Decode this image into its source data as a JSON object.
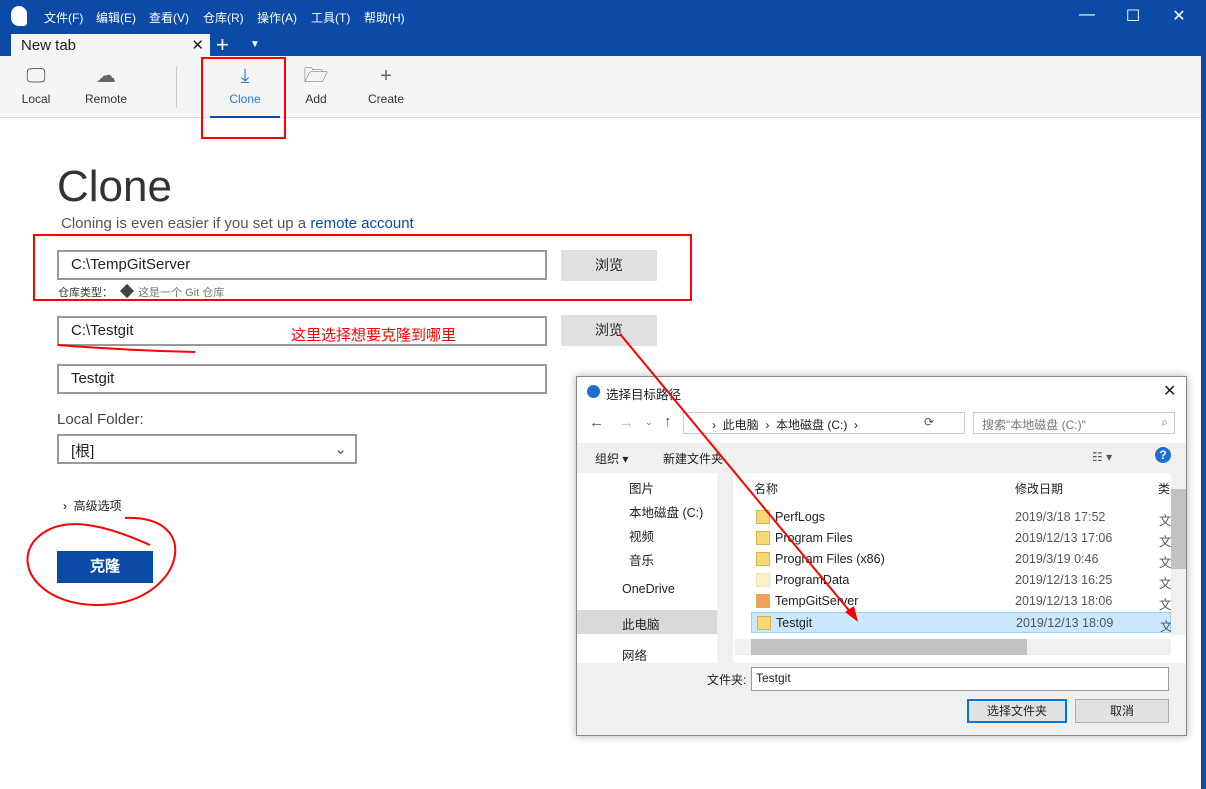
{
  "app": {
    "menu": [
      "文件(F)",
      "编辑(E)",
      "查看(V)",
      "仓库(R)",
      "操作(A)",
      "工具(T)",
      "帮助(H)"
    ],
    "tab_label": "New tab"
  },
  "toolbar": {
    "local": "Local",
    "remote": "Remote",
    "clone": "Clone",
    "add": "Add",
    "create": "Create",
    "accent": "#1e7be0"
  },
  "clone": {
    "title": "Clone",
    "subtitle": "Cloning is even easier if you set up a ",
    "subtitle_link": "remote account",
    "source": "C:\\TempGitServer",
    "browse": "浏览",
    "repo_type_label": "仓库类型：",
    "repo_type": "这是一个 Git 仓库",
    "dest": "C:\\Testgit",
    "name": "Testgit",
    "local_folder_label": "Local Folder:",
    "local_folder": "[根]",
    "advanced": "高级选项",
    "clone_button": "克隆"
  },
  "annotation": {
    "note": "这里选择想要克隆到哪里",
    "color": "#ff0000"
  },
  "dialog": {
    "title": "选择目标路径",
    "breadcrumb": [
      "此电脑",
      "本地磁盘 (C:)"
    ],
    "search_placeholder": "搜索\"本地磁盘 (C:)\"",
    "organize": "组织",
    "new_folder": "新建文件夹",
    "nav": [
      "图片",
      "本地磁盘 (C:)",
      "视频",
      "音乐",
      "OneDrive",
      "此电脑",
      "网络"
    ],
    "columns": [
      "名称",
      "修改日期",
      "类"
    ],
    "files": [
      {
        "name": "PerfLogs",
        "date": "2019/3/18 17:52",
        "type": "文"
      },
      {
        "name": "Program Files",
        "date": "2019/12/13 17:06",
        "type": "文"
      },
      {
        "name": "Program Files (x86)",
        "date": "2019/3/19 0:46",
        "type": "文"
      },
      {
        "name": "ProgramData",
        "date": "2019/12/13 16:25",
        "type": "文"
      },
      {
        "name": "TempGitServer",
        "date": "2019/12/13 18:06",
        "type": "文"
      },
      {
        "name": "Testgit",
        "date": "2019/12/13 18:09",
        "type": "文"
      }
    ],
    "folder_label": "文件夹:",
    "folder_value": "Testgit",
    "select": "选择文件夹",
    "cancel": "取消"
  }
}
